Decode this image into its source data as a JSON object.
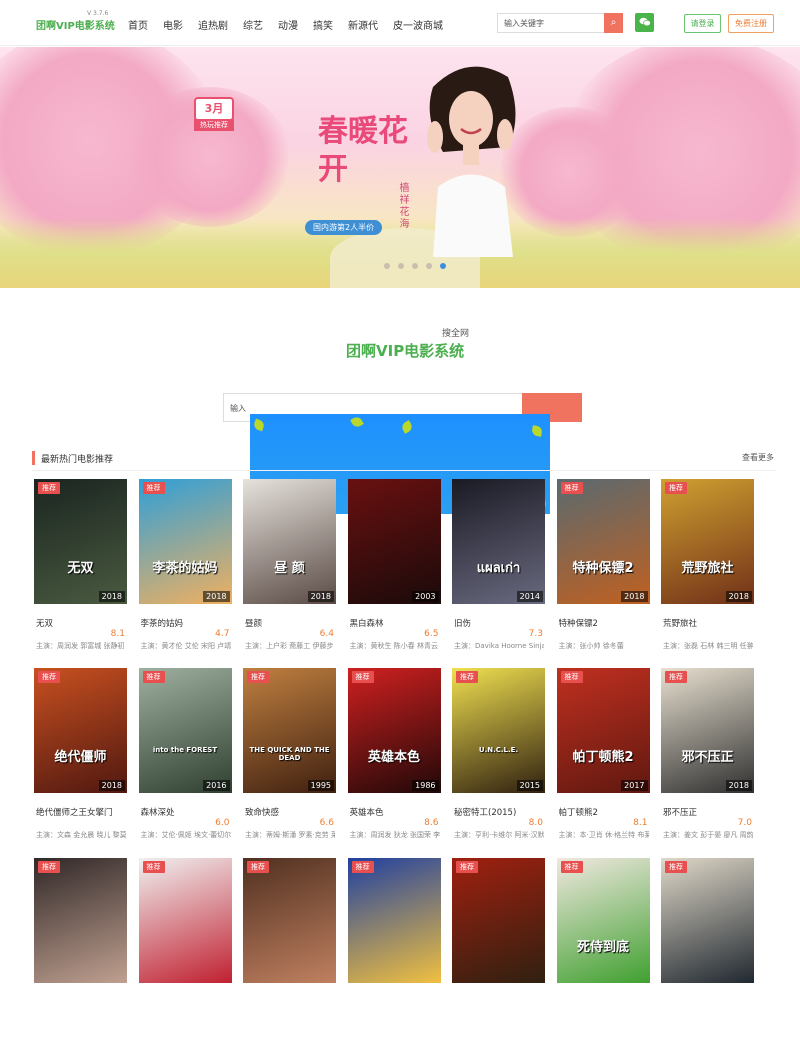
{
  "header": {
    "logo": "团啊VIP电影系统",
    "version": "V 3.7.6",
    "nav": [
      "首页",
      "电影",
      "追热剧",
      "综艺",
      "动漫",
      "搞笑",
      "新源代",
      "皮一波商城"
    ],
    "search_placeholder": "输入关键字",
    "login_label": "请登录",
    "register_label": "免费注册"
  },
  "banner": {
    "badge_month": "3月",
    "badge_label": "热玩推荐",
    "slogan_main": "春暖花开",
    "slogan_side": "樯祥花海",
    "promo": "国内游第2人半价",
    "slide_count": 5,
    "active_slide": 5
  },
  "search_section": {
    "label": "搜全网",
    "site_title": "团啊VIP电影系统",
    "input_text": "输入"
  },
  "movies_section": {
    "title": "最新热门电影推荐",
    "more_label": "查看更多",
    "tag_label": "推荐",
    "rows": [
      [
        {
          "title": "无双",
          "score": "8.1",
          "cast": "主演：周润发 郭富城 张静初 ...",
          "year": "2018",
          "poster_text": "无双",
          "colors": [
            "#1a2520",
            "#4a5a40"
          ],
          "tag": true
        },
        {
          "title": "李茶的姑妈",
          "score": "4.7",
          "cast": "主演：黄才伦 艾伦 宋阳 卢靖...",
          "year": "2018",
          "poster_text": "李茶的姑妈",
          "colors": [
            "#2f9fd8",
            "#f0b060"
          ],
          "tag": true
        },
        {
          "title": "昼颜",
          "score": "6.4",
          "cast": "主演：上户彩 斋藤工 伊藤步 ...",
          "year": "2018",
          "poster_text": "昼 颜",
          "colors": [
            "#e6e2dc",
            "#5a4a45"
          ],
          "tag": false
        },
        {
          "title": "黑白森林",
          "score": "6.5",
          "cast": "主演：黄秋生 陈小春 林青云 ...",
          "year": "2003",
          "poster_text": "",
          "colors": [
            "#6a1010",
            "#1a0a0a"
          ],
          "tag": false
        },
        {
          "title": "旧伤",
          "score": "7.3",
          "cast": "主演：Davika Hoorne Sinjai ...",
          "year": "2014",
          "poster_text": "แผลเก่า",
          "colors": [
            "#1a1a24",
            "#6a6a80"
          ],
          "tag": false
        },
        {
          "title": "特种保镖2",
          "score": "",
          "cast": "主演：张小帅 徐冬蕾",
          "year": "2018",
          "poster_text": "特种保镖2",
          "colors": [
            "#5a6a70",
            "#c06020"
          ],
          "tag": true
        },
        {
          "title": "荒野旅社",
          "score": "",
          "cast": "主演：张磊 石林 韩三明 任翀 ...",
          "year": "2018",
          "poster_text": "荒野旅社",
          "colors": [
            "#d0a030",
            "#703018"
          ],
          "tag": true
        }
      ],
      [
        {
          "title": "绝代僵师之王女擎门",
          "score": "",
          "cast": "主演：文森 金允晨 晓儿 黎莫...",
          "year": "2018",
          "poster_text": "绝代僵师",
          "colors": [
            "#c85020",
            "#501810"
          ],
          "tag": true
        },
        {
          "title": "森林深处",
          "score": "6.0",
          "cast": "主演：艾伦·佩姬 埃文·蕾切尔·...",
          "year": "2016",
          "poster_text": "into the FOREST",
          "colors": [
            "#a0b0a0",
            "#304030"
          ],
          "tag": true
        },
        {
          "title": "致命快感",
          "score": "6.6",
          "cast": "主演：蒂姆·斯潘 罗素·克劳 莱...",
          "year": "1995",
          "poster_text": "THE QUICK AND THE DEAD",
          "colors": [
            "#c08040",
            "#402010"
          ],
          "tag": true
        },
        {
          "title": "英雄本色",
          "score": "8.6",
          "cast": "主演：周润发 狄龙 张国荣 李...",
          "year": "1986",
          "poster_text": "英雄本色",
          "colors": [
            "#d02020",
            "#200808"
          ],
          "tag": true
        },
        {
          "title": "秘密特工(2015)",
          "score": "8.0",
          "cast": "主演：亨利·卡维尔 阿米·汉默 ...",
          "year": "2015",
          "poster_text": "U.N.C.L.E.",
          "colors": [
            "#f0e050",
            "#302010"
          ],
          "tag": true
        },
        {
          "title": "帕丁顿熊2",
          "score": "8.1",
          "cast": "主演：本·卫肖 休·格兰特 布莱...",
          "year": "2017",
          "poster_text": "帕丁顿熊2",
          "colors": [
            "#c03020",
            "#601810"
          ],
          "tag": true
        },
        {
          "title": "邪不压正",
          "score": "7.0",
          "cast": "主演：姜文 彭于晏 廖凡 周韵 ...",
          "year": "2018",
          "poster_text": "邪不压正",
          "colors": [
            "#e8e0d0",
            "#303030"
          ],
          "tag": true
        }
      ],
      [
        {
          "title": "",
          "score": "",
          "cast": "",
          "year": "",
          "poster_text": "",
          "colors": [
            "#302828",
            "#c0a090"
          ],
          "tag": true
        },
        {
          "title": "",
          "score": "",
          "cast": "",
          "year": "",
          "poster_text": "",
          "colors": [
            "#f0f0f0",
            "#c02030"
          ],
          "tag": true
        },
        {
          "title": "",
          "score": "",
          "cast": "",
          "year": "",
          "poster_text": "",
          "colors": [
            "#503020",
            "#c08060"
          ],
          "tag": true
        },
        {
          "title": "",
          "score": "",
          "cast": "",
          "year": "",
          "poster_text": "",
          "colors": [
            "#2040a0",
            "#f0c040"
          ],
          "tag": true
        },
        {
          "title": "",
          "score": "",
          "cast": "",
          "year": "",
          "poster_text": "",
          "colors": [
            "#a02010",
            "#302010"
          ],
          "tag": true
        },
        {
          "title": "",
          "score": "",
          "cast": "",
          "year": "",
          "poster_text": "死侍到底",
          "colors": [
            "#f0e8e0",
            "#40a030"
          ],
          "tag": true
        },
        {
          "title": "",
          "score": "",
          "cast": "",
          "year": "",
          "poster_text": "",
          "colors": [
            "#e0d8c8",
            "#202830"
          ],
          "tag": true
        }
      ]
    ]
  }
}
